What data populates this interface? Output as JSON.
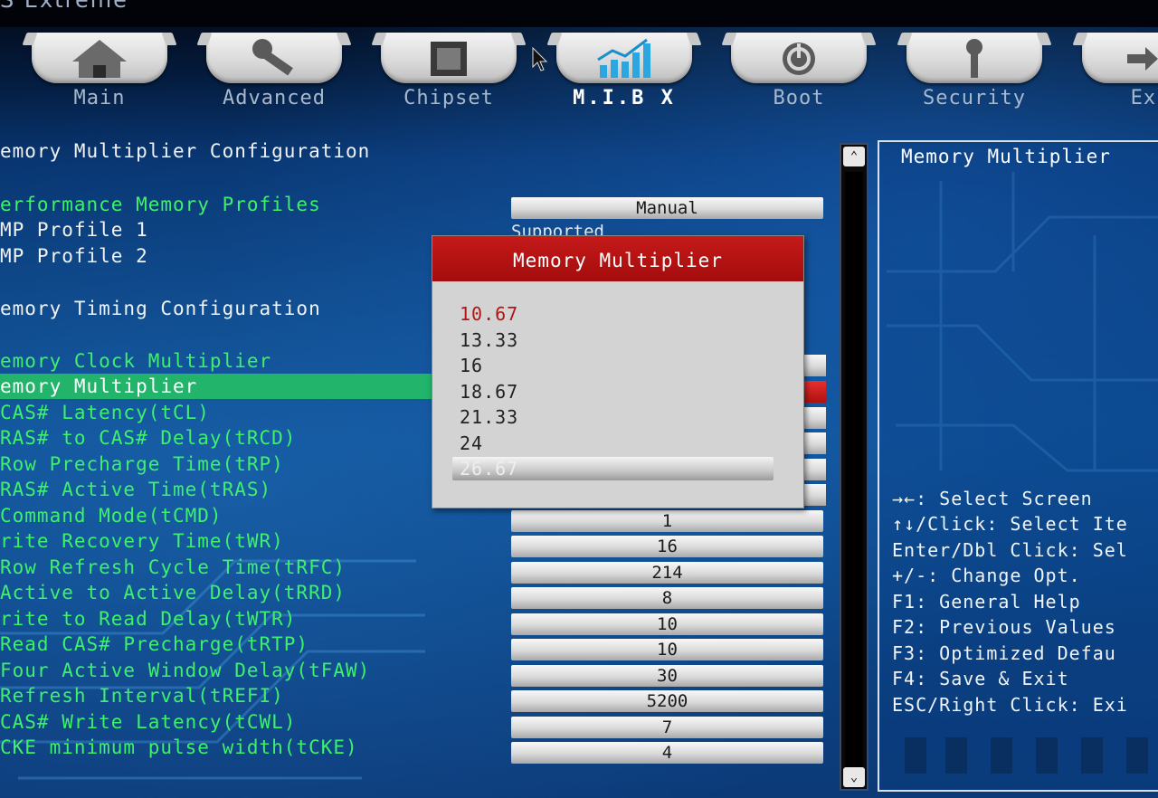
{
  "bios": {
    "brand_fragment": "S Extreme"
  },
  "tabs": [
    {
      "label": "Main",
      "icon": "home-icon"
    },
    {
      "label": "Advanced",
      "icon": "wrench-icon"
    },
    {
      "label": "Chipset",
      "icon": "chip-icon"
    },
    {
      "label": "M.I.B X",
      "icon": "chart-icon"
    },
    {
      "label": "Boot",
      "icon": "power-icon"
    },
    {
      "label": "Security",
      "icon": "key-icon"
    },
    {
      "label": "Exi",
      "icon": "exit-icon"
    }
  ],
  "active_tab": "M.I.B X",
  "menu": {
    "section1": "emory Multiplier Configuration",
    "xmp_header": "erformance Memory Profiles",
    "xmp1": "MP Profile 1",
    "xmp2": "MP Profile 2",
    "section2": "emory Timing Configuration",
    "clock_mult": "emory Clock Multiplier",
    "mem_mult": "emory Multiplier",
    "items": [
      {
        "label": "CAS# Latency(tCL)",
        "value": ""
      },
      {
        "label": "RAS# to CAS# Delay(tRCD)",
        "value": ""
      },
      {
        "label": "Row Precharge Time(tRP)",
        "value": ""
      },
      {
        "label": "RAS# Active Time(tRAS)",
        "value": ""
      },
      {
        "label": "Command Mode(tCMD)",
        "value": "1"
      },
      {
        "label": "rite Recovery Time(tWR)",
        "value": "16"
      },
      {
        "label": "Row Refresh Cycle Time(tRFC)",
        "value": "214"
      },
      {
        "label": "Active to Active Delay(tRRD)",
        "value": "8"
      },
      {
        "label": "rite to Read Delay(tWTR)",
        "value": "10"
      },
      {
        "label": "Read CAS# Precharge(tRTP)",
        "value": "10"
      },
      {
        "label": "Four Active Window Delay(tFAW)",
        "value": "30"
      },
      {
        "label": "Refresh Interval(tREFI)",
        "value": "5200"
      },
      {
        "label": "CAS# Write Latency(tCWL)",
        "value": "7"
      },
      {
        "label": "CKE minimum pulse width(tCKE)",
        "value": "4"
      }
    ]
  },
  "values": {
    "xmp_mode": "Manual",
    "supported": "Supported"
  },
  "popup": {
    "title": "Memory Multiplier",
    "options": [
      "10.67",
      "13.33",
      "16",
      "18.67",
      "21.33",
      "24",
      "26.67"
    ],
    "current": "10.67",
    "highlighted": "26.67"
  },
  "scrollbar": {
    "up": "⌃",
    "down": "⌄"
  },
  "help": {
    "title": "Memory Multiplier",
    "keys": [
      "→←: Select Screen",
      "↑↓/Click: Select Ite",
      "Enter/Dbl Click: Sel",
      "+/-: Change Opt.",
      "F1: General Help",
      "F2: Previous Values",
      "F3: Optimized Defau",
      "F4: Save & Exit",
      "ESC/Right Click: Exi"
    ]
  },
  "colors": {
    "green": "#3ef06c",
    "selected_row": "#21b46a",
    "popup_title": "#b41414",
    "current_option": "#b01616"
  }
}
